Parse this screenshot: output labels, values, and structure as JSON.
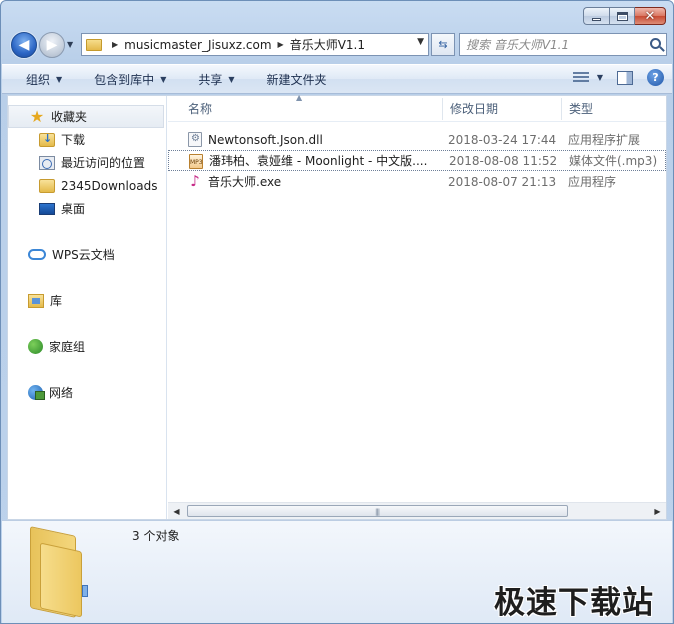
{
  "address": {
    "segments": [
      "musicmaster_Jisuxz.com",
      "音乐大师V1.1"
    ]
  },
  "search": {
    "placeholder": "搜索 音乐大师V1.1"
  },
  "toolbar": {
    "organize": "组织",
    "include_library": "包含到库中",
    "share": "共享",
    "new_folder": "新建文件夹"
  },
  "nav": {
    "favorites": "收藏夹",
    "downloads": "下载",
    "recent": "最近访问的位置",
    "downloads2345": "2345Downloads",
    "desktop": "桌面",
    "wps": "WPS云文档",
    "libraries": "库",
    "homegroup": "家庭组",
    "network": "网络"
  },
  "columns": {
    "name": "名称",
    "date": "修改日期",
    "type": "类型"
  },
  "files": [
    {
      "name": "Newtonsoft.Json.dll",
      "date": "2018-03-24 17:44",
      "type": "应用程序扩展",
      "icon": "dll-icon"
    },
    {
      "name": "潘玮柏、袁娅维 - Moonlight - 中文版....",
      "date": "2018-08-08 11:52",
      "type": "媒体文件(.mp3)",
      "icon": "mp3-icon"
    },
    {
      "name": "音乐大师.exe",
      "date": "2018-08-07 21:13",
      "type": "应用程序",
      "icon": "music-note-icon"
    }
  ],
  "details": {
    "count": "3 个对象"
  },
  "watermark": "极速下载站"
}
